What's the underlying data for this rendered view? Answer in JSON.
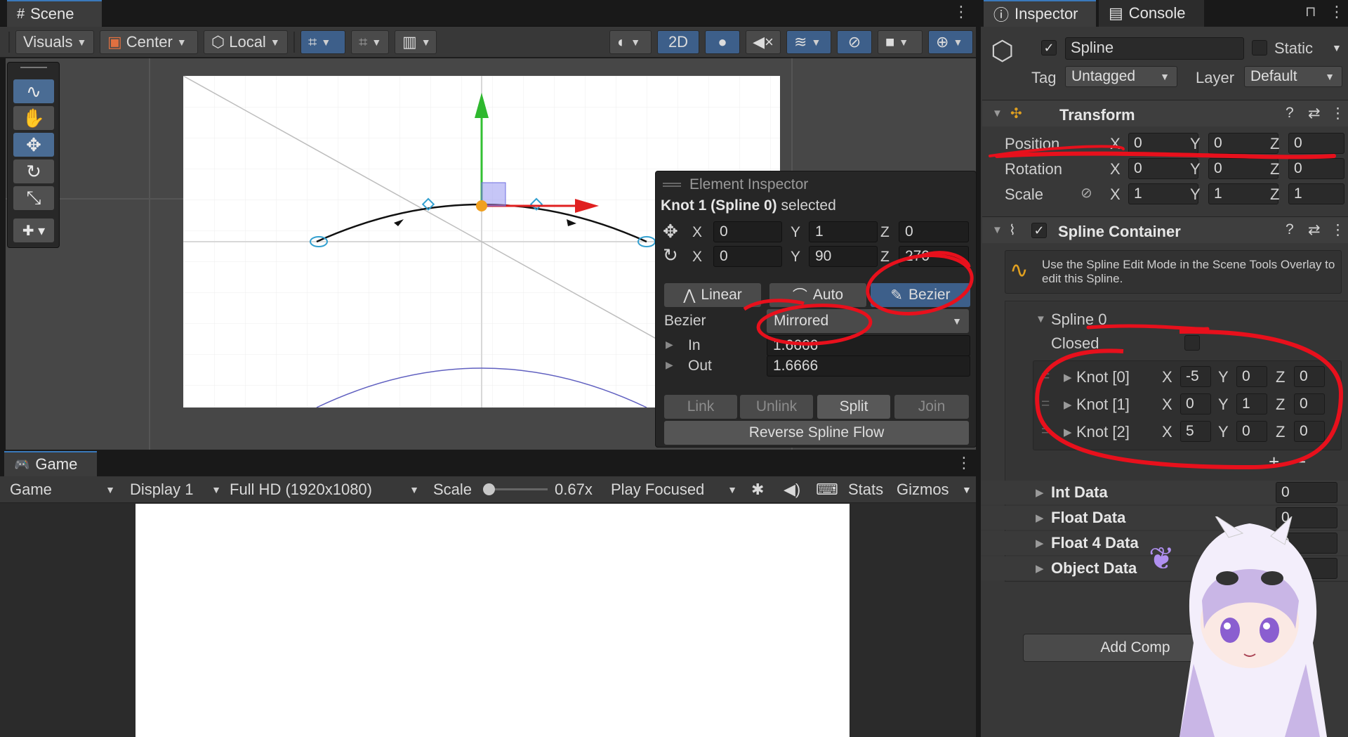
{
  "scene": {
    "tab_label": "Scene",
    "toolbar": {
      "visuals": "Visuals",
      "center": "Center",
      "local": "Local",
      "mode_2d": "2D"
    }
  },
  "element_inspector": {
    "title": "Element Inspector",
    "selection_name": "Knot 1 (Spline 0)",
    "selection_suffix": "selected",
    "position": {
      "x": "0",
      "y": "1",
      "z": "0"
    },
    "rotation": {
      "x": "0",
      "y": "90",
      "z": "270"
    },
    "axis_x": "X",
    "axis_y": "Y",
    "axis_z": "Z",
    "tangent_modes": [
      "Linear",
      "Auto",
      "Bezier"
    ],
    "bezier_label": "Bezier",
    "bezier_mode": "Mirrored",
    "in_label": "In",
    "in_value": "1.6666",
    "out_label": "Out",
    "out_value": "1.6666",
    "actions": [
      "Link",
      "Unlink",
      "Split",
      "Join"
    ],
    "reverse_label": "Reverse Spline Flow"
  },
  "game": {
    "tab_label": "Game",
    "mode": "Game",
    "display": "Display 1",
    "resolution": "Full HD (1920x1080)",
    "scale_label": "Scale",
    "scale_value": "0.67x",
    "play_mode": "Play Focused",
    "stats": "Stats",
    "gizmos": "Gizmos"
  },
  "inspector": {
    "tab_inspector": "Inspector",
    "tab_console": "Console",
    "object_name": "Spline",
    "static_label": "Static",
    "tag_label": "Tag",
    "tag_value": "Untagged",
    "layer_label": "Layer",
    "layer_value": "Default",
    "transform": {
      "title": "Transform",
      "position_label": "Position",
      "rotation_label": "Rotation",
      "scale_label": "Scale",
      "position": {
        "x": "0",
        "y": "0",
        "z": "0"
      },
      "rotation": {
        "x": "0",
        "y": "0",
        "z": "0"
      },
      "scale": {
        "x": "1",
        "y": "1",
        "z": "1"
      }
    },
    "spline_container": {
      "title": "Spline Container",
      "help_text": "Use the Spline Edit Mode in the Scene Tools Overlay to edit this Spline.",
      "spline_label": "Spline 0",
      "closed_label": "Closed",
      "knots": [
        {
          "label": "Knot [0]",
          "x": "-5",
          "y": "0",
          "z": "0"
        },
        {
          "label": "Knot [1]",
          "x": "0",
          "y": "1",
          "z": "0"
        },
        {
          "label": "Knot [2]",
          "x": "5",
          "y": "0",
          "z": "0"
        }
      ],
      "plus": "+",
      "minus": "−",
      "data_rows": [
        {
          "label": "Int Data",
          "value": "0"
        },
        {
          "label": "Float Data",
          "value": "0"
        },
        {
          "label": "Float 4 Data",
          "value": "0"
        },
        {
          "label": "Object Data",
          "value": ""
        }
      ]
    },
    "add_component": "Add Comp"
  },
  "colors": {
    "accent": "#3d5f8a",
    "annotation": "#e8101c",
    "panel": "#383838",
    "scene_bg": "#474747"
  }
}
